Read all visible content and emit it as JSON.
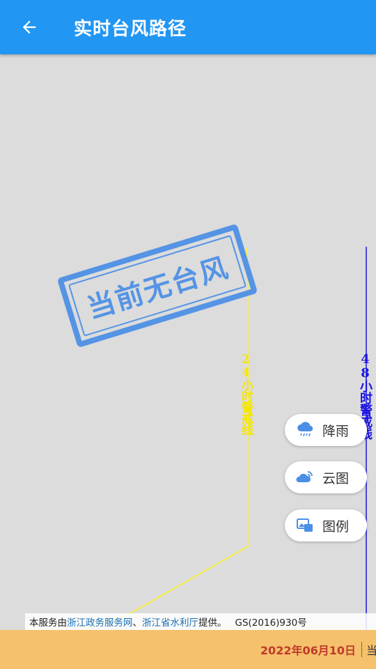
{
  "header": {
    "title": "实时台风路径"
  },
  "map": {
    "stamp_text": "当前无台风",
    "warning_24h": "24小时警戒线",
    "warning_48h": "48小时警戒线",
    "colors": {
      "warning_24h": "#f5e600",
      "warning_48h": "#1a14e6",
      "stamp": "#4a8ee6"
    }
  },
  "fabs": [
    {
      "label": "降雨",
      "icon": "rain-cloud-icon"
    },
    {
      "label": "云图",
      "icon": "cloud-image-icon"
    },
    {
      "label": "图例",
      "icon": "legend-icon"
    }
  ],
  "attribution": {
    "prefix": "本服务由",
    "link1": "浙江政务服务网",
    "sep": "、",
    "link2": "浙江省水利厅",
    "suffix": "提供。",
    "gs": "GS(2016)930号"
  },
  "bottom": {
    "date": "2022年06月10日",
    "current": "当"
  }
}
